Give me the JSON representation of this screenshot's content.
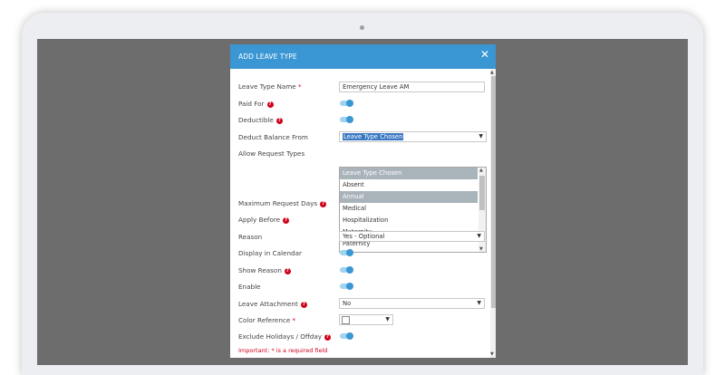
{
  "modal": {
    "title": "ADD LEAVE TYPE"
  },
  "fields": {
    "leave_type_name": {
      "label": "Leave Type Name",
      "value": "Emergency Leave AM"
    },
    "paid_for": {
      "label": "Paid For",
      "on": true
    },
    "deductible": {
      "label": "Deductible",
      "on": true
    },
    "deduct_balance_from": {
      "label": "Deduct Balance From",
      "value": "Leave Type Chosen"
    },
    "allow_request_types": {
      "label": "Allow Request Types"
    },
    "maximum_request_days": {
      "label": "Maximum Request Days"
    },
    "apply_before": {
      "label": "Apply Before"
    },
    "reason": {
      "label": "Reason",
      "value": "Yes - Optional"
    },
    "display_in_calendar": {
      "label": "Display in Calendar",
      "on": true
    },
    "show_reason": {
      "label": "Show Reason",
      "on": true
    },
    "enable": {
      "label": "Enable",
      "on": true
    },
    "leave_attachment": {
      "label": "Leave Attachment",
      "value": "No"
    },
    "color_reference": {
      "label": "Color Reference"
    },
    "exclude_holidays": {
      "label": "Exclude Holidays / Offday",
      "on": true
    }
  },
  "dropdown_options": [
    {
      "label": "Leave Type Chosen",
      "selected": true
    },
    {
      "label": "Absent",
      "selected": false
    },
    {
      "label": "Annual",
      "selected": true
    },
    {
      "label": "Medical",
      "selected": false
    },
    {
      "label": "Hospitalization",
      "selected": false
    },
    {
      "label": "Maternity",
      "selected": false
    },
    {
      "label": "Paternity",
      "selected": false
    }
  ],
  "required_marker": "*",
  "help_glyph": "?",
  "close_glyph": "✕",
  "note": "Important: * is a required field",
  "colors": {
    "header": "#3a97d4",
    "toggle": "#3a97d4",
    "required": "#d0021b",
    "backdrop": "#6d6d6d"
  }
}
